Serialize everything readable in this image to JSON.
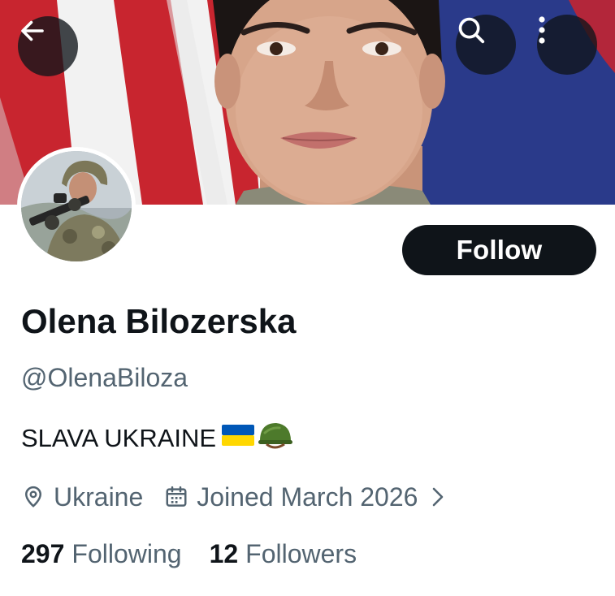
{
  "header": {
    "back_icon": "arrow-left-icon",
    "search_icon": "search-icon",
    "more_icon": "more-vertical-icon"
  },
  "profile": {
    "name": "Olena Bilozerska",
    "handle": "@OlenaBiloza",
    "bio": "SLAVA UKRAINE",
    "bio_emoji": [
      "ukraine-flag-icon",
      "military-helmet-icon"
    ],
    "location": "Ukraine",
    "joined": "Joined March 2026"
  },
  "actions": {
    "follow_label": "Follow"
  },
  "stats": {
    "following_count": "297",
    "following_label": "Following",
    "followers_count": "12",
    "followers_label": "Followers"
  },
  "colors": {
    "text_primary": "#0f1419",
    "text_secondary": "#536471",
    "button_dark": "#0f1419",
    "flag_blue": "#0057b7",
    "flag_yellow": "#ffd700"
  }
}
